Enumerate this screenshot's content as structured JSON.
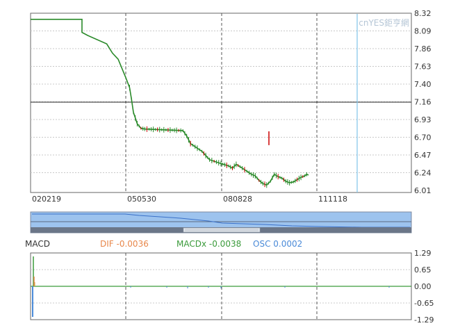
{
  "watermark": "cnYES鉅亨網",
  "colors": {
    "up": "#cc0000",
    "down": "#2a8a2a",
    "cursor": "#7fc3ea",
    "dif": "#e8874a",
    "macdx": "#3a9a3a",
    "osc": "#4a8ad8",
    "navigator": "#9dc3ee"
  },
  "chart_data": [
    {
      "type": "line",
      "panel": "price",
      "y_ticks": [
        "8.32",
        "8.09",
        "7.86",
        "7.63",
        "7.40",
        "7.16",
        "6.93",
        "6.70",
        "6.47",
        "6.24",
        "6.01"
      ],
      "ylim": [
        6.01,
        8.32
      ],
      "x_ticks": [
        "020219",
        "050530",
        "080828",
        "111118"
      ],
      "reference_line": 7.16,
      "series": [
        {
          "x": [
            0.0,
            0.05,
            0.1,
            0.135,
            0.135,
            0.15,
            0.2,
            0.215,
            0.23,
            0.24,
            0.25,
            0.26,
            0.265,
            0.27,
            0.28,
            0.29,
            0.3,
            0.35,
            0.4,
            0.41,
            0.42,
            0.45,
            0.47,
            0.5,
            0.52,
            0.53,
            0.54,
            0.55,
            0.58,
            0.59,
            0.6,
            0.61,
            0.62,
            0.63,
            0.64,
            0.65,
            0.66,
            0.67,
            0.68,
            0.69,
            0.7,
            0.71,
            0.72,
            0.725,
            0.73
          ],
          "y": [
            8.24,
            8.24,
            8.24,
            8.24,
            8.07,
            8.03,
            7.92,
            7.8,
            7.72,
            7.6,
            7.48,
            7.35,
            7.2,
            7.03,
            6.88,
            6.82,
            6.81,
            6.8,
            6.79,
            6.72,
            6.62,
            6.52,
            6.41,
            6.36,
            6.33,
            6.3,
            6.35,
            6.32,
            6.22,
            6.2,
            6.14,
            6.1,
            6.08,
            6.13,
            6.22,
            6.19,
            6.17,
            6.13,
            6.11,
            6.12,
            6.15,
            6.18,
            6.2,
            6.22,
            6.21
          ]
        }
      ]
    },
    {
      "type": "line",
      "panel": "macd",
      "y_ticks": [
        "1.29",
        "0.65",
        "0.00",
        "-0.65",
        "-1.29"
      ],
      "ylim": [
        -1.29,
        1.29
      ],
      "legend": [
        {
          "label": "MACD"
        },
        {
          "label": "DIF",
          "value": "-0.0036"
        },
        {
          "label": "MACDx",
          "value": "-0.0038"
        },
        {
          "label": "OSC",
          "value": "0.0002"
        }
      ]
    }
  ]
}
